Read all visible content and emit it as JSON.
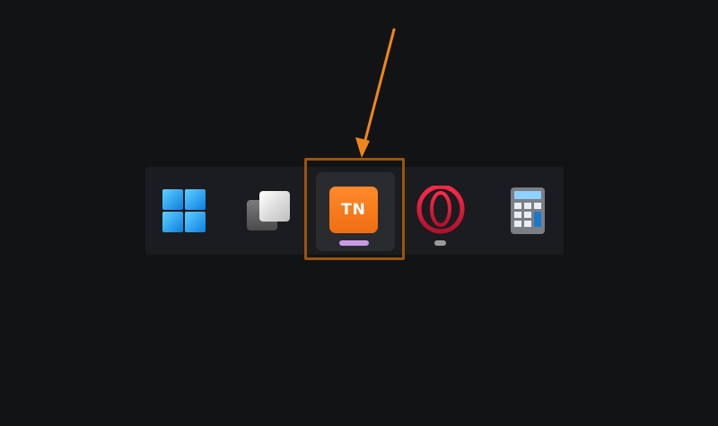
{
  "taskbar": {
    "items": [
      {
        "name": "start",
        "icon": "windows-logo-icon"
      },
      {
        "name": "task-view",
        "icon": "task-view-icon"
      },
      {
        "name": "tn-app",
        "icon": "tn-app-icon",
        "label": "TN",
        "active": true
      },
      {
        "name": "opera",
        "icon": "opera-icon",
        "running": true
      },
      {
        "name": "calculator",
        "icon": "calculator-icon"
      }
    ]
  },
  "colors": {
    "background": "#121315",
    "taskbar": "#1b1c1f",
    "highlight_box": "#9a5408",
    "arrow": "#f0861b",
    "tn_tile": "#f37415",
    "active_indicator": "#c89be3",
    "running_indicator": "#9a9a9a",
    "windows_blue": "#1fa2f0",
    "opera_red": "#d11735"
  }
}
